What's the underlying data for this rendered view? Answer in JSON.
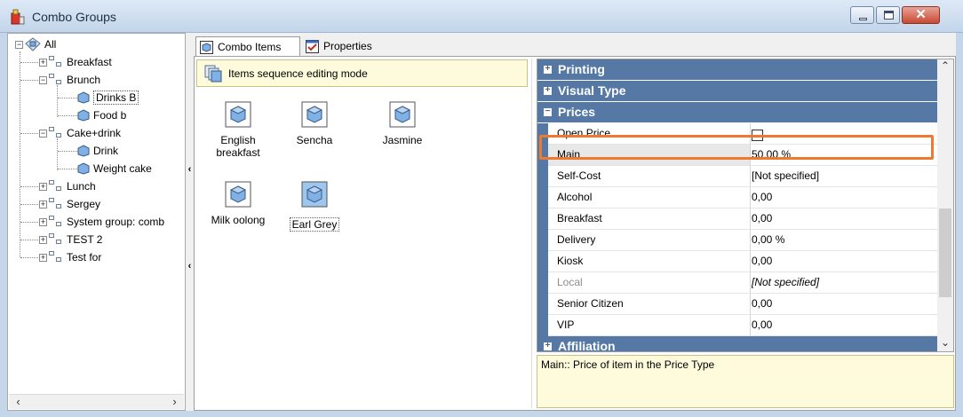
{
  "window": {
    "title": "Combo Groups"
  },
  "tree": {
    "items": [
      {
        "label": "All"
      },
      {
        "label": "Breakfast"
      },
      {
        "label": "Brunch"
      },
      {
        "label": "Drinks B"
      },
      {
        "label": "Food b"
      },
      {
        "label": "Cake+drink"
      },
      {
        "label": "Drink"
      },
      {
        "label": "Weight cake"
      },
      {
        "label": "Lunch"
      },
      {
        "label": "Sergey"
      },
      {
        "label": "System group: comb"
      },
      {
        "label": "TEST 2"
      },
      {
        "label": "Test for"
      }
    ]
  },
  "tabs": [
    {
      "label": "Combo Items"
    },
    {
      "label": "Properties"
    }
  ],
  "sequence_mode_label": "Items sequence editing mode",
  "combo_items": [
    {
      "name_line1": "English",
      "name_line2": "breakfast"
    },
    {
      "name_line1": "Sencha",
      "name_line2": ""
    },
    {
      "name_line1": "Jasmine",
      "name_line2": ""
    },
    {
      "name_line1": "Milk oolong",
      "name_line2": ""
    },
    {
      "name_line1": "Earl Grey",
      "name_line2": ""
    }
  ],
  "properties": {
    "categories": {
      "printing": "Printing",
      "visual_type": "Visual Type",
      "prices": "Prices",
      "affiliation": "Affiliation"
    },
    "rows": [
      {
        "name": "Open Price",
        "value": ""
      },
      {
        "name": "Main",
        "value": "50,00 %"
      },
      {
        "name": "Self-Cost",
        "value": "[Not specified]"
      },
      {
        "name": "Alcohol",
        "value": "0,00"
      },
      {
        "name": "Breakfast",
        "value": "0,00"
      },
      {
        "name": "Delivery",
        "value": "0,00 %"
      },
      {
        "name": "Kiosk",
        "value": "0,00"
      },
      {
        "name": "Local",
        "value": "[Not specified]"
      },
      {
        "name": "Senior Citizen",
        "value": "0,00"
      },
      {
        "name": "VIP",
        "value": "0,00"
      }
    ]
  },
  "description": "Main:: Price of item in the Price Type",
  "colors": {
    "category_header": "#5579a4",
    "highlight": "#ef7a2f",
    "info_background": "#fdfbdb"
  }
}
